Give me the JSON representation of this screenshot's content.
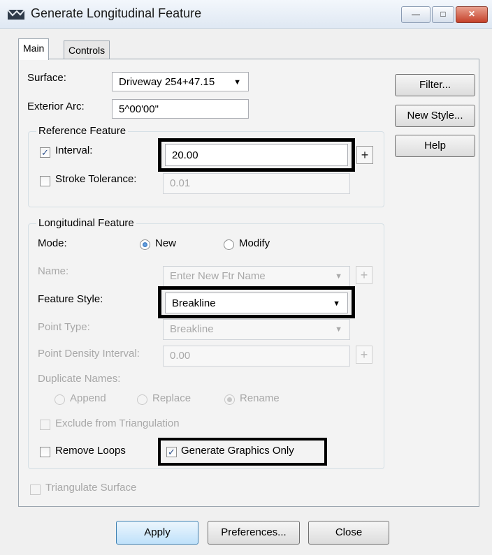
{
  "window": {
    "title": "Generate Longitudinal Feature",
    "app_icon": "feature-line-icon",
    "controls": {
      "minimize": "—",
      "maximize": "□",
      "close": "✕"
    }
  },
  "tabs": [
    {
      "label": "Main",
      "selected": true
    },
    {
      "label": "Controls",
      "selected": false
    }
  ],
  "main": {
    "surface": {
      "label": "Surface:",
      "value": "Driveway 254+47.15"
    },
    "exterior_arc": {
      "label": "Exterior Arc:",
      "value": "5^00'00\""
    },
    "reference_feature": {
      "title": "Reference Feature",
      "interval": {
        "label": "Interval:",
        "checked": true,
        "value": "20.00"
      },
      "stroke_tolerance": {
        "label": "Stroke Tolerance:",
        "checked": false,
        "value": "0.01"
      }
    },
    "longitudinal_feature": {
      "title": "Longitudinal Feature",
      "mode": {
        "label": "Mode:",
        "options": [
          "New",
          "Modify"
        ],
        "selected": "New"
      },
      "name": {
        "label": "Name:",
        "placeholder": "Enter New Ftr Name"
      },
      "feature_style": {
        "label": "Feature Style:",
        "value": "Breakline"
      },
      "point_type": {
        "label": "Point Type:",
        "value": "Breakline"
      },
      "point_density_interval": {
        "label": "Point Density Interval:",
        "value": "0.00"
      },
      "duplicate_names": {
        "label": "Duplicate Names:",
        "options": [
          "Append",
          "Replace",
          "Rename"
        ],
        "selected": "Rename"
      },
      "exclude_from_triangulation": {
        "label": "Exclude from Triangulation",
        "checked": false
      },
      "remove_loops": {
        "label": "Remove Loops",
        "checked": false
      },
      "generate_graphics_only": {
        "label": "Generate Graphics Only",
        "checked": true
      }
    },
    "triangulate_surface": {
      "label": "Triangulate Surface",
      "checked": false
    }
  },
  "side_buttons": {
    "filter": "Filter...",
    "new_style": "New Style...",
    "help": "Help"
  },
  "footer_buttons": {
    "apply": "Apply",
    "preferences": "Preferences...",
    "close": "Close"
  },
  "glyphs": {
    "check": "✓",
    "dropdown": "▼",
    "pick": "+"
  }
}
